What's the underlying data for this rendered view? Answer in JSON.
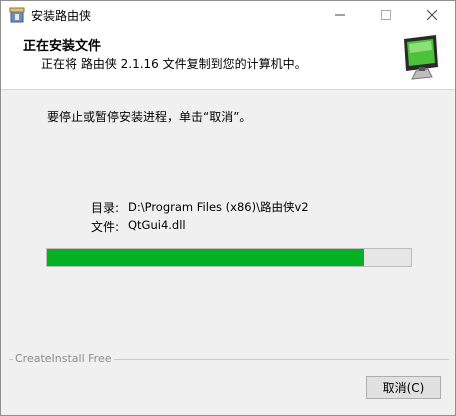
{
  "window": {
    "title": "安装路由侠",
    "icon": "installer-box-icon",
    "controls": {
      "minimize": "minimize-icon",
      "maximize": "maximize-icon",
      "close": "close-icon"
    }
  },
  "header": {
    "title": "正在安装文件",
    "subtitle": "正在将 路由侠 2.1.16 文件复制到您的计算机中。",
    "icon": "computer-monitor-icon"
  },
  "body": {
    "message": "要停止或暂停安装进程，单击“取消”。",
    "directory_label": "目录:",
    "directory_value": "D:\\Program Files (x86)\\路由侠v2",
    "file_label": "文件:",
    "file_value": "QtGui4.dll",
    "progress_fraction": 0.87
  },
  "footer": {
    "brand": "CreateInstall Free",
    "cancel_label": "取消(C)"
  },
  "colors": {
    "progress": "#06b025",
    "window_bg": "#f0f0f0",
    "header_bg": "#ffffff"
  }
}
